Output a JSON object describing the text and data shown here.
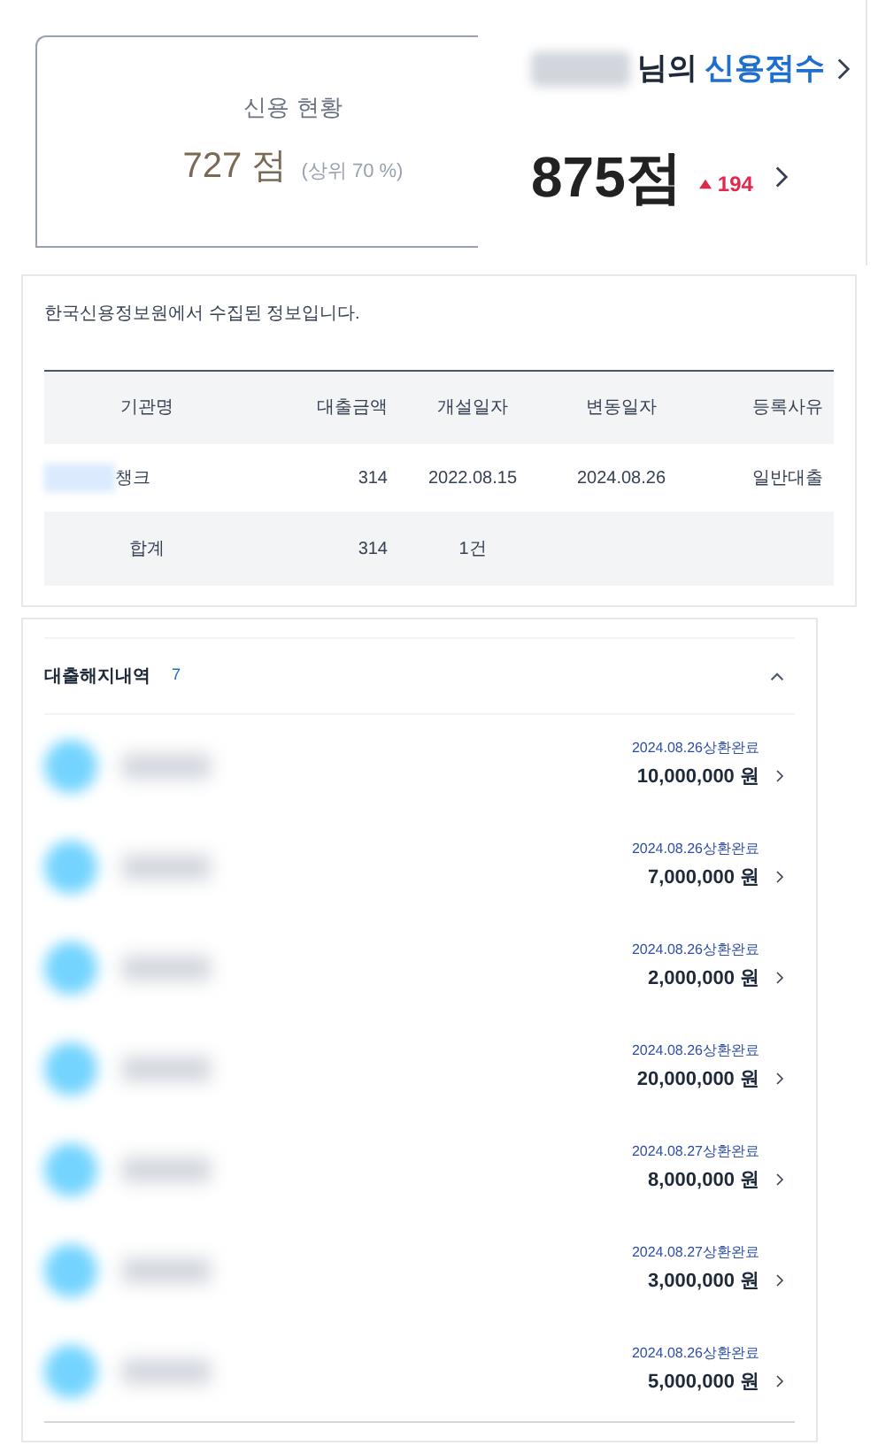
{
  "credit_status": {
    "title": "신용 현황",
    "score": "727 점",
    "percentile": "(상위 70 %)"
  },
  "credit_score": {
    "suffix": "님의",
    "title": "신용점수",
    "score": "875점",
    "change": "194"
  },
  "loan_table": {
    "notice": "한국신용정보원에서 수집된 정보입니다.",
    "columns": [
      "기관명",
      "대출금액",
      "개설일자",
      "변동일자",
      "등록사유"
    ],
    "rows": [
      [
        "챙크",
        "314",
        "2022.08.15",
        "2024.08.26",
        "일반대출"
      ]
    ],
    "total": [
      "합계",
      "314",
      "1건"
    ]
  },
  "closed_loans": {
    "title": "대출해지내역",
    "count": "7",
    "expanded": true,
    "items": [
      {
        "status": "2024.08.26상환완료",
        "amount": "10,000,000 원"
      },
      {
        "status": "2024.08.26상환완료",
        "amount": "7,000,000 원"
      },
      {
        "status": "2024.08.26상환완료",
        "amount": "2,000,000 원"
      },
      {
        "status": "2024.08.26상환완료",
        "amount": "20,000,000 원"
      },
      {
        "status": "2024.08.27상환완료",
        "amount": "8,000,000 원"
      },
      {
        "status": "2024.08.27상환완료",
        "amount": "3,000,000 원"
      },
      {
        "status": "2024.08.26상환완료",
        "amount": "5,000,000 원"
      }
    ]
  }
}
